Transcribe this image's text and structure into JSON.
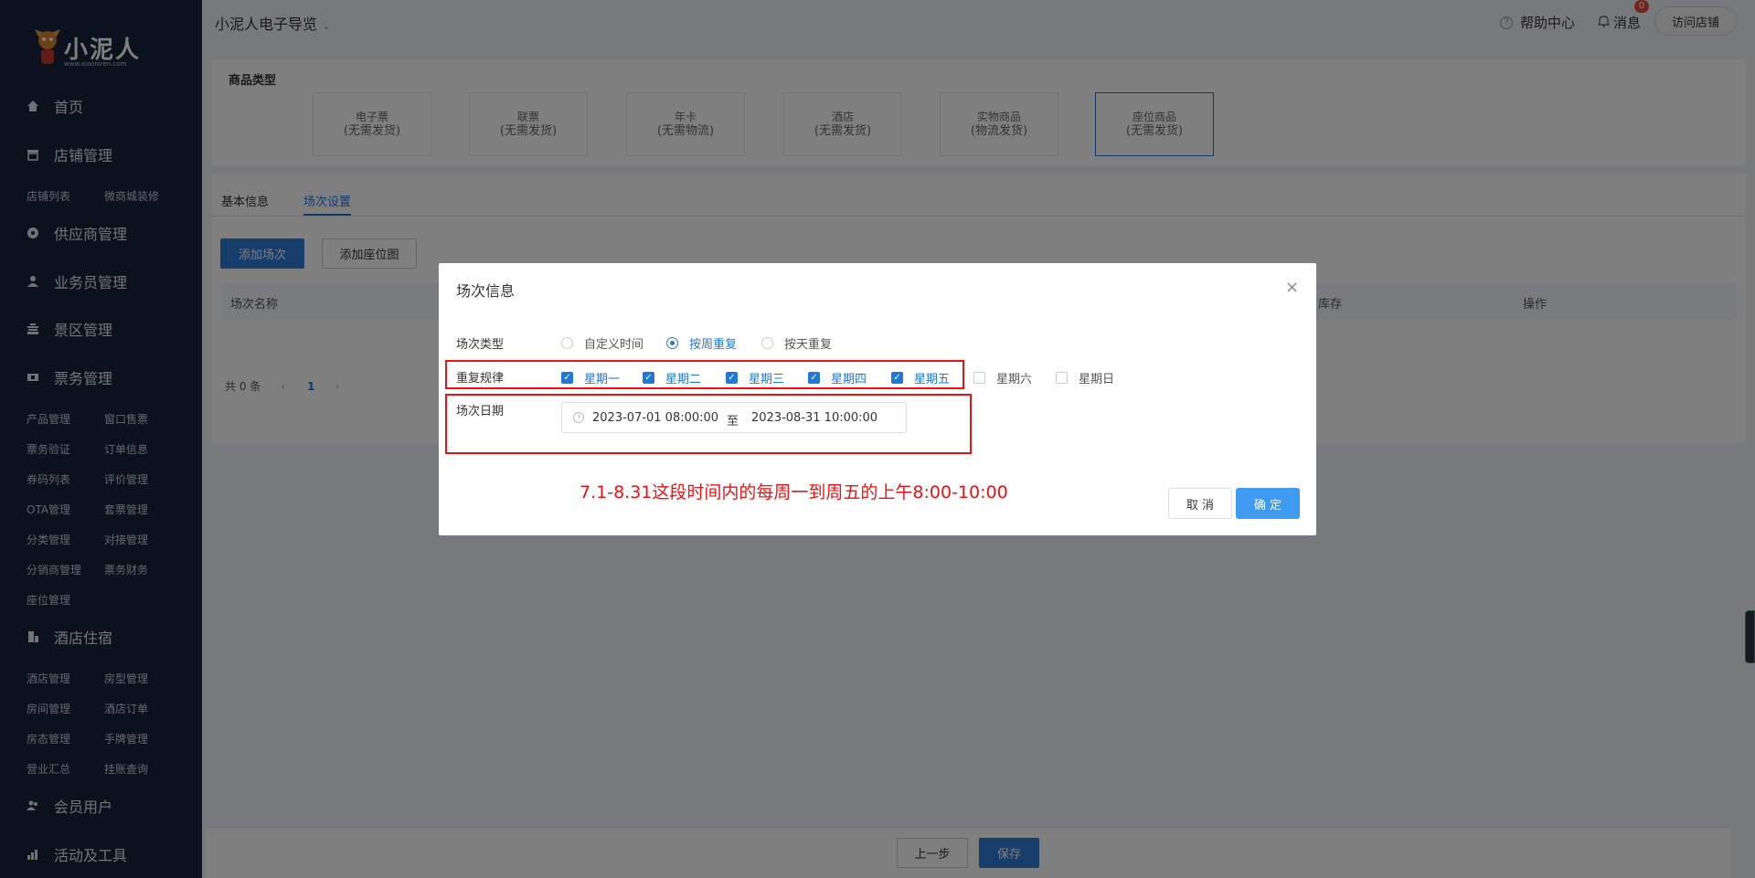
{
  "sidebar": {
    "logo_text": "小泥人",
    "logo_url": "www.xiaoniren.com",
    "main": [
      {
        "label": "首页",
        "icon": "home-icon"
      },
      {
        "label": "店铺管理",
        "icon": "store-icon"
      },
      {
        "label": "供应商管理",
        "icon": "supplier-icon"
      },
      {
        "label": "业务员管理",
        "icon": "user-icon"
      },
      {
        "label": "景区管理",
        "icon": "scenic-icon"
      },
      {
        "label": "票务管理",
        "icon": "ticket-icon"
      },
      {
        "label": "酒店住宿",
        "icon": "hotel-icon"
      },
      {
        "label": "会员用户",
        "icon": "members-icon"
      },
      {
        "label": "活动及工具",
        "icon": "chart-icon"
      }
    ],
    "store_sub": [
      "店铺列表",
      "微商城装修"
    ],
    "ticket_sub": [
      "产品管理",
      "窗口售票",
      "票务验证",
      "订单信息",
      "券码列表",
      "评价管理",
      "OTA管理",
      "套票管理",
      "分类管理",
      "对接管理",
      "分销商管理",
      "票务财务",
      "座位管理"
    ],
    "hotel_sub": [
      "酒店管理",
      "房型管理",
      "房间管理",
      "酒店订单",
      "房态管理",
      "手牌管理",
      "营业汇总",
      "挂账查询"
    ]
  },
  "header": {
    "app_title": "小泥人电子导览",
    "help": "帮助中心",
    "messages": "消息",
    "badge": "0",
    "visit_store": "访问店铺"
  },
  "product_type": {
    "title": "商品类型",
    "cards": [
      {
        "name": "电子票",
        "sub": "(无需发货)"
      },
      {
        "name": "联票",
        "sub": "(无需发货)"
      },
      {
        "name": "年卡",
        "sub": "(无需物流)"
      },
      {
        "name": "酒店",
        "sub": "(无需发货)"
      },
      {
        "name": "实物商品",
        "sub": "(物流发货)"
      },
      {
        "name": "座位商品",
        "sub": "(无需发货)"
      }
    ]
  },
  "tabs": [
    "基本信息",
    "场次设置"
  ],
  "actions": {
    "add_session": "添加场次",
    "add_seatmap": "添加座位图"
  },
  "table": {
    "headers": [
      "场次名称",
      "库存",
      "操作"
    ]
  },
  "pagination": {
    "total": "共 0 条",
    "prev": "‹",
    "current": "1",
    "next": "›"
  },
  "footer": {
    "prev_step": "上一步",
    "save": "保存"
  },
  "modal": {
    "title": "场次信息",
    "close": "×",
    "type_label": "场次类型",
    "type_options": [
      "自定义时间",
      "按周重复",
      "按天重复"
    ],
    "selected_type": 1,
    "repeat_label": "重复规律",
    "weekdays": [
      "星期一",
      "星期二",
      "星期三",
      "星期四",
      "星期五",
      "星期六",
      "星期日"
    ],
    "weekdays_checked": [
      true,
      true,
      true,
      true,
      true,
      false,
      false
    ],
    "date_label": "场次日期",
    "date_start": "2023-07-01 08:00:00",
    "date_sep": "至",
    "date_end": "2023-08-31 10:00:00",
    "annotation": "7.1-8.31这段时间内的每周一到周五的上午8:00-10:00",
    "cancel": "取 消",
    "confirm": "确 定"
  }
}
